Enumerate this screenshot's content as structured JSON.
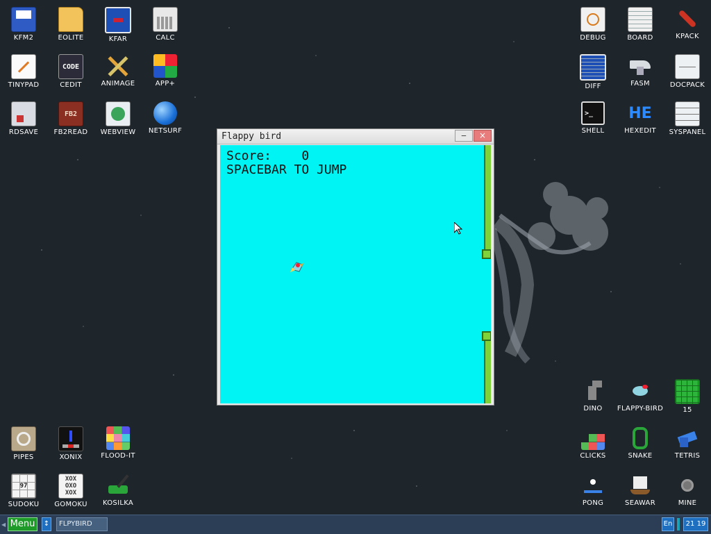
{
  "desktop": {
    "icons_left": [
      {
        "label": "KFM2",
        "icon": "floppy-icon"
      },
      {
        "label": "EOLITE",
        "icon": "folder-icon"
      },
      {
        "label": "KFAR",
        "icon": "panels-icon"
      },
      {
        "label": "CALC",
        "icon": "calculator-icon"
      },
      {
        "label": "TINYPAD",
        "icon": "notepad-icon"
      },
      {
        "label": "CEDIT",
        "icon": "code-icon",
        "text": "CODE"
      },
      {
        "label": "ANIMAGE",
        "icon": "pencil-ruler-icon"
      },
      {
        "label": "APP+",
        "icon": "cube-icon"
      },
      {
        "label": "RDSAVE",
        "icon": "disk-save-icon"
      },
      {
        "label": "FB2READ",
        "icon": "book-icon",
        "text": "FB2"
      },
      {
        "label": "WEBVIEW",
        "icon": "web-icon"
      },
      {
        "label": "NETSURF",
        "icon": "globe-icon"
      },
      {
        "label": "PIPES",
        "icon": "pipes-icon"
      },
      {
        "label": "XONIX",
        "icon": "xonix-icon"
      },
      {
        "label": "FLOOD-IT",
        "icon": "color-grid-icon"
      },
      {
        "label": "SUDOKU",
        "icon": "sudoku-icon"
      },
      {
        "label": "GOMOKU",
        "icon": "gomoku-icon"
      },
      {
        "label": "KOSILKA",
        "icon": "lawnmower-icon"
      }
    ],
    "icons_right": [
      {
        "label": "DEBUG",
        "icon": "bug-icon"
      },
      {
        "label": "BOARD",
        "icon": "board-icon"
      },
      {
        "label": "KPACK",
        "icon": "wrench-icon"
      },
      {
        "label": "DIFF",
        "icon": "diff-icon"
      },
      {
        "label": "FASM",
        "icon": "anvil-icon"
      },
      {
        "label": "DOCPACK",
        "icon": "cabinet-icon"
      },
      {
        "label": "SHELL",
        "icon": "terminal-icon",
        "text": ">_"
      },
      {
        "label": "HEXEDIT",
        "icon": "hex-icon",
        "text": "HE"
      },
      {
        "label": "SYSPANEL",
        "icon": "sliders-icon"
      },
      {
        "label": "DINO",
        "icon": "dino-icon"
      },
      {
        "label": "FLAPPY-BIRD",
        "icon": "bird-icon"
      },
      {
        "label": "15",
        "icon": "fifteen-icon"
      },
      {
        "label": "CLICKS",
        "icon": "blocks-icon"
      },
      {
        "label": "SNAKE",
        "icon": "snake-icon"
      },
      {
        "label": "TETRIS",
        "icon": "tetris-icon"
      },
      {
        "label": "PONG",
        "icon": "pong-icon"
      },
      {
        "label": "SEAWAR",
        "icon": "ship-icon"
      },
      {
        "label": "MINE",
        "icon": "mine-icon"
      }
    ]
  },
  "window": {
    "title": "Flappy bird",
    "minimize_label": "‒",
    "close_label": "×",
    "score_line": "Score:    0",
    "hint": "SPACEBAR TO JUMP"
  },
  "taskbar": {
    "menu_label": "Menu",
    "arrows_label": "↕",
    "task_label": "FLPYBIRD",
    "lang": "En",
    "clock": "21 19"
  },
  "colors": {
    "game_bg": "#00f4f4",
    "pipe": "#7fd23a",
    "taskbar": "#2c3e55",
    "menu_button": "#1d9a28"
  }
}
